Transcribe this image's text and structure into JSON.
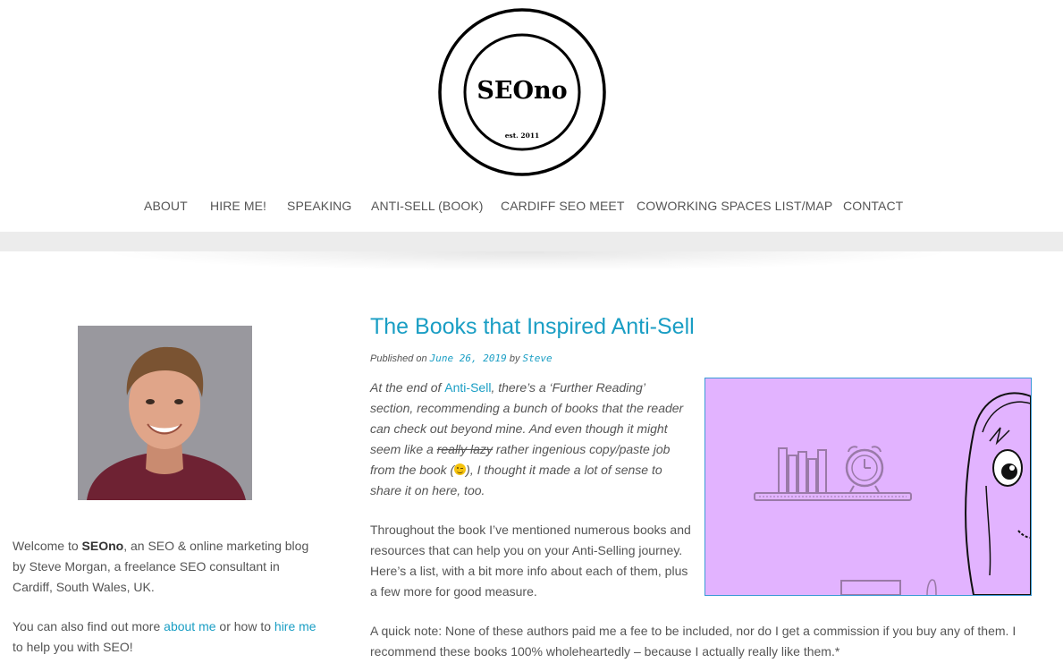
{
  "site": {
    "logo_text": "SEOno",
    "logo_est": "est. 2011"
  },
  "nav": {
    "items": [
      {
        "label": "ABOUT"
      },
      {
        "label": "HIRE ME!"
      },
      {
        "label": "SPEAKING"
      },
      {
        "label": "ANTI-SELL (BOOK)"
      },
      {
        "label": "CARDIFF SEO MEET"
      },
      {
        "label": "COWORKING SPACES LIST/MAP"
      },
      {
        "label": "CONTACT"
      }
    ]
  },
  "sidebar": {
    "welcome_prefix": "Welcome to ",
    "welcome_brand": "SEOno",
    "welcome_suffix": ", an SEO & online marketing blog by Steve Morgan, a freelance SEO consultant in Cardiff, South Wales, UK.",
    "more_prefix": "You can also find out more ",
    "about_link": "about me",
    "more_middle": " or how to ",
    "hire_link": "hire me",
    "more_suffix": " to help you with SEO!"
  },
  "post": {
    "title": "The Books that Inspired Anti-Sell",
    "published_label": "Published on ",
    "date": "June 26, 2019",
    "by_label": " by ",
    "author": "Steve",
    "p1_a": "At the end of ",
    "p1_link": "Anti-Sell",
    "p1_b": ", there’s a ‘Further Reading’ section, recommending a bunch of books that the reader can check out beyond mine. And even though it might seem like a ",
    "p1_strike": "really lazy",
    "p1_c": " rather ingenious copy/paste job from the book (",
    "p1_d": "), I thought it made a lot of sense to share it on here, too.",
    "p2": "Throughout the book I’ve mentioned numerous books and resources that can help you on your Anti-Selling journey. Here’s a list, with a bit more info about each of them, plus a few more for good measure.",
    "p3": "A quick note: None of these authors paid me a fee to be included, nor do I get a commission if you buy any of them. I recommend these books 100% wholeheartedly – because I actually really like them.*"
  },
  "colors": {
    "link": "#1a9ec4",
    "text": "#555555",
    "feature_bg": "#e2b3ff"
  }
}
